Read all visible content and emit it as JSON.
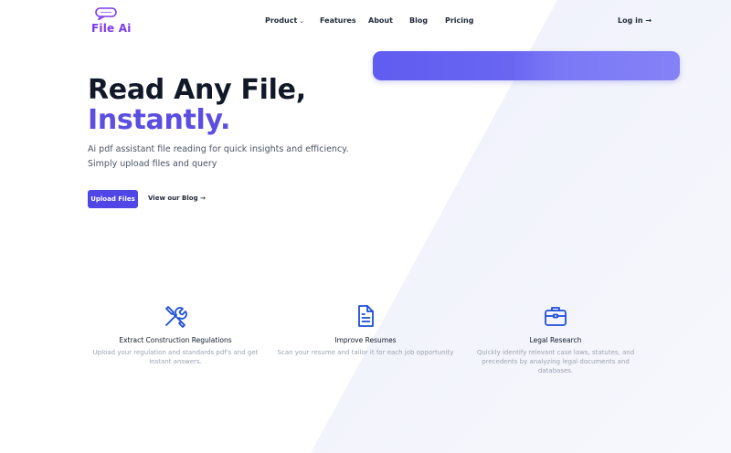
{
  "header": {
    "logo_text": "File Ai",
    "nav": [
      {
        "label": "Product",
        "has_dropdown": true
      },
      {
        "label": "Features"
      },
      {
        "label": "About"
      },
      {
        "label": "Blog"
      },
      {
        "label": "Pricing"
      }
    ],
    "login_label": "Log in →"
  },
  "hero": {
    "title_line1": "Read Any File,",
    "title_line2": "Instantly.",
    "subtitle_line1": "Ai pdf assistant file reading for quick insights and efficiency.",
    "subtitle_line2": "Simply upload files and query",
    "upload_button": "Upload Files",
    "blog_link": "View our Blog →"
  },
  "features": [
    {
      "icon": "tools-icon",
      "title": "Extract Construction Regulations",
      "description": "Upload your regulation and standards pdf's and get instant answers."
    },
    {
      "icon": "document-icon",
      "title": "Improve Resumes",
      "description": "Scan your resume and tailor it for each job opportunity"
    },
    {
      "icon": "briefcase-icon",
      "title": "Legal Research",
      "description": "Quickly identify relevant case laws, statutes, and precedents by analyzing legal documents and databases."
    }
  ],
  "colors": {
    "brand": "#5b4ee0",
    "button": "#4f46e5",
    "banner_start": "#5f5cf0",
    "banner_end": "#8582f7",
    "icon": "#1d4ed8"
  }
}
